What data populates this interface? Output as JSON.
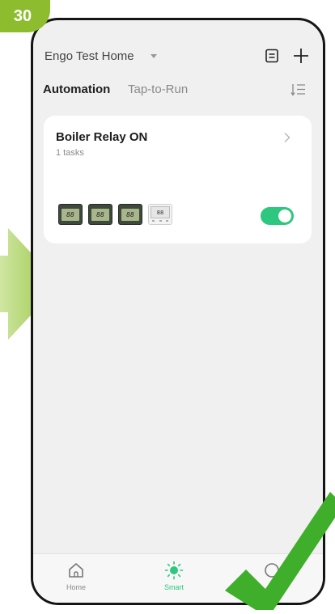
{
  "step": {
    "number": "30"
  },
  "header": {
    "home_name": "Engo Test Home",
    "icons": {
      "log": "document-icon",
      "add": "plus-icon",
      "sort": "sort-icon"
    }
  },
  "tabs": [
    {
      "label": "Automation",
      "active": true
    },
    {
      "label": "Tap-to-Run",
      "active": false
    }
  ],
  "automations": [
    {
      "name": "Boiler Relay ON",
      "subtitle": "1 tasks",
      "device_lcd": [
        "88",
        "88",
        "88",
        "88"
      ],
      "enabled": true
    }
  ],
  "bottom_nav": [
    {
      "label": "Home",
      "icon": "home-icon",
      "active": false
    },
    {
      "label": "Smart",
      "icon": "smart-sun-icon",
      "active": true
    },
    {
      "label": "",
      "icon": "me-icon",
      "active": false
    }
  ],
  "colors": {
    "badge": "#8dbd2e",
    "arrow": "#a6cf4f",
    "toggle_on": "#2ec77f",
    "check": "#3fae2a"
  }
}
